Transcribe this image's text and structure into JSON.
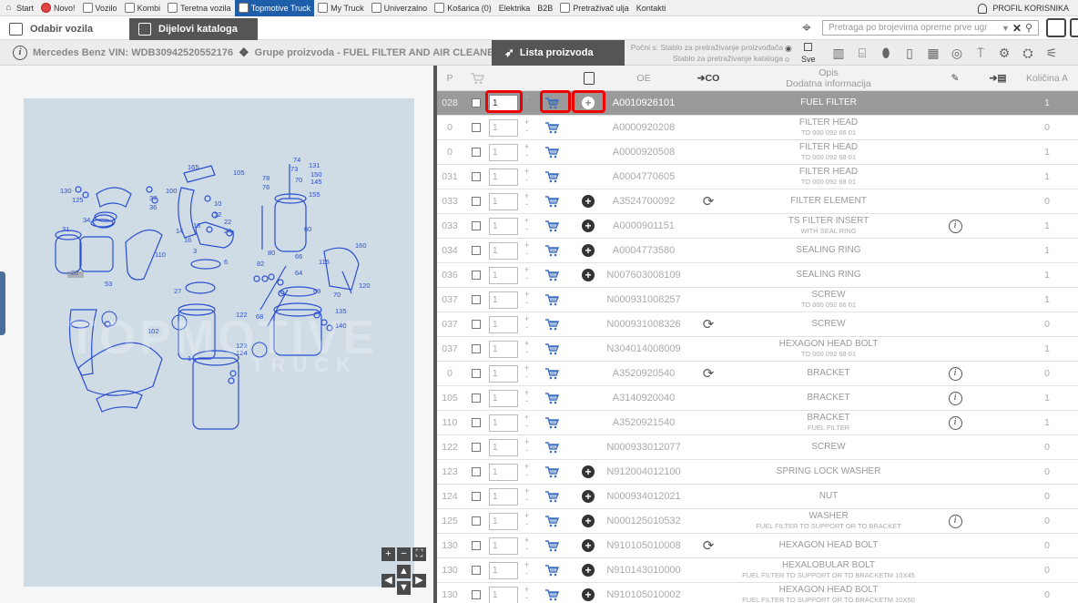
{
  "topnav": {
    "items": [
      {
        "label": "Start",
        "icon": "home-icon"
      },
      {
        "label": "Novo!",
        "icon": "new-badge-icon"
      },
      {
        "label": "Vozilo",
        "icon": "car-icon"
      },
      {
        "label": "Kombi",
        "icon": "van-icon"
      },
      {
        "label": "Teretna vozila",
        "icon": "truck-icon"
      },
      {
        "label": "Topmotive Truck",
        "icon": "topmotive-truck-icon"
      },
      {
        "label": "My Truck",
        "icon": "my-truck-icon"
      },
      {
        "label": "Univerzalno",
        "icon": "universal-icon"
      },
      {
        "label": "Košarica (0)",
        "icon": "cart-icon"
      },
      {
        "label": "Elektrika",
        "icon": ""
      },
      {
        "label": "B2B",
        "icon": ""
      },
      {
        "label": "Pretraživač ulja",
        "icon": "oil-icon"
      },
      {
        "label": "Kontakti",
        "icon": ""
      }
    ],
    "profile_label": "PROFIL KORISNIKA"
  },
  "bar2": {
    "tab_odabir": "Odabir vozila",
    "tab_dijelovi": "Dijelovi kataloga",
    "search_placeholder": "Pretraga po brojevima opreme prve ugr"
  },
  "bar3": {
    "vin": "Mercedes Benz VIN: WDB30942520552176",
    "grupe": "Grupe proizvoda - FUEL FILTER AND AIR CLEANER",
    "lista": "Lista proizvoda",
    "pocni_line1": "Počni s: Stablo za pretraživanje proizvođača",
    "pocni_line2": "Stablo za pretraživanje kataloga",
    "sve": "Sve"
  },
  "table": {
    "headers": {
      "p": "P",
      "oe": "OE",
      "opis": "Opis",
      "dodatna": "Dodatna informacija",
      "kolicina": "Količina A"
    },
    "rows": [
      {
        "p": "028",
        "qty": "1",
        "oe": "A0010926101",
        "opis": "FUEL FILTER",
        "sub": "",
        "plus": true,
        "co": false,
        "info": false,
        "k": "1"
      },
      {
        "p": "0",
        "qty": "1",
        "oe": "A0000920208",
        "opis": "FILTER HEAD",
        "sub": "TO 000 092 66 01",
        "plus": false,
        "co": false,
        "info": false,
        "k": "0"
      },
      {
        "p": "0",
        "qty": "1",
        "oe": "A0000920508",
        "opis": "FILTER HEAD",
        "sub": "TO 000 092 68 01",
        "plus": false,
        "co": false,
        "info": false,
        "k": "1"
      },
      {
        "p": "031",
        "qty": "1",
        "oe": "A0004770605",
        "opis": "FILTER HEAD",
        "sub": "TO 000 092 68 01",
        "plus": false,
        "co": false,
        "info": false,
        "k": "1"
      },
      {
        "p": "033",
        "qty": "1",
        "oe": "A3524700092",
        "opis": "FILTER ELEMENT",
        "sub": "",
        "plus": true,
        "co": true,
        "info": false,
        "k": "0"
      },
      {
        "p": "033",
        "qty": "1",
        "oe": "A0000901151",
        "opis": "TS FILTER INSERT",
        "sub": "WITH SEAL RING",
        "plus": true,
        "co": false,
        "info": true,
        "k": "1"
      },
      {
        "p": "034",
        "qty": "1",
        "oe": "A0004773580",
        "opis": "SEALING RING",
        "sub": "",
        "plus": true,
        "co": false,
        "info": false,
        "k": "1"
      },
      {
        "p": "036",
        "qty": "1",
        "oe": "N007603008109",
        "opis": "SEALING RING",
        "sub": "",
        "plus": true,
        "co": false,
        "info": false,
        "k": "1"
      },
      {
        "p": "037",
        "qty": "1",
        "oe": "N000931008257",
        "opis": "SCREW",
        "sub": "TO 000 092 66 01",
        "plus": false,
        "co": false,
        "info": false,
        "k": "1"
      },
      {
        "p": "037",
        "qty": "1",
        "oe": "N000931008326",
        "opis": "SCREW",
        "sub": "",
        "plus": false,
        "co": true,
        "info": false,
        "k": "0"
      },
      {
        "p": "037",
        "qty": "1",
        "oe": "N304014008009",
        "opis": "HEXAGON HEAD BOLT",
        "sub": "TO 000 092 68 01",
        "plus": false,
        "co": false,
        "info": false,
        "k": "1"
      },
      {
        "p": "0",
        "qty": "1",
        "oe": "A3520920540",
        "opis": "BRACKET",
        "sub": "",
        "plus": false,
        "co": true,
        "info": true,
        "k": "0"
      },
      {
        "p": "105",
        "qty": "1",
        "oe": "A3140920040",
        "opis": "BRACKET",
        "sub": "",
        "plus": false,
        "co": false,
        "info": true,
        "k": "1"
      },
      {
        "p": "110",
        "qty": "1",
        "oe": "A3520921540",
        "opis": "BRACKET",
        "sub": "FUEL FILTER",
        "plus": false,
        "co": false,
        "info": true,
        "k": "1"
      },
      {
        "p": "122",
        "qty": "1",
        "oe": "N000933012077",
        "opis": "SCREW",
        "sub": "",
        "plus": false,
        "co": false,
        "info": false,
        "k": "0"
      },
      {
        "p": "123",
        "qty": "1",
        "oe": "N912004012100",
        "opis": "SPRING LOCK WASHER",
        "sub": "",
        "plus": true,
        "co": false,
        "info": false,
        "k": "0"
      },
      {
        "p": "124",
        "qty": "1",
        "oe": "N000934012021",
        "opis": "NUT",
        "sub": "",
        "plus": true,
        "co": false,
        "info": false,
        "k": "0"
      },
      {
        "p": "125",
        "qty": "1",
        "oe": "N000125010532",
        "opis": "WASHER",
        "sub": "FUEL FILTER TO SUPPORT OR TO BRACKET",
        "plus": true,
        "co": false,
        "info": true,
        "k": "0"
      },
      {
        "p": "130",
        "qty": "1",
        "oe": "N910105010008",
        "opis": "HEXAGON HEAD BOLT",
        "sub": "",
        "plus": true,
        "co": true,
        "info": false,
        "k": "0"
      },
      {
        "p": "130",
        "qty": "1",
        "oe": "N910143010000",
        "opis": "HEXALOBULAR BOLT",
        "sub": "FUEL FILTER TO SUPPORT OR TO BRACKETM 10X45",
        "plus": true,
        "co": false,
        "info": false,
        "k": "0"
      },
      {
        "p": "130",
        "qty": "1",
        "oe": "N910105010002",
        "opis": "HEXAGON HEAD BOLT",
        "sub": "FUEL FILTER TO SUPPORT OR TO BRACKETM 10X50",
        "plus": true,
        "co": false,
        "info": false,
        "k": "0"
      }
    ]
  },
  "diagram": {
    "watermark_line1": "TOPMOTIVE",
    "watermark_line2": "TRUCK",
    "labels": [
      "130",
      "125",
      "165",
      "105",
      "37",
      "36",
      "100",
      "10",
      "12",
      "22",
      "24",
      "3",
      "6",
      "31",
      "34",
      "110",
      "18",
      "14",
      "16",
      "78",
      "76",
      "74",
      "73",
      "131",
      "150",
      "145",
      "70",
      "155",
      "60",
      "82",
      "80",
      "66",
      "64",
      "69",
      "70",
      "135",
      "140",
      "160",
      "115",
      "120",
      "27",
      "53",
      "68",
      "122",
      "102",
      "1",
      "123",
      "124",
      "28"
    ]
  }
}
